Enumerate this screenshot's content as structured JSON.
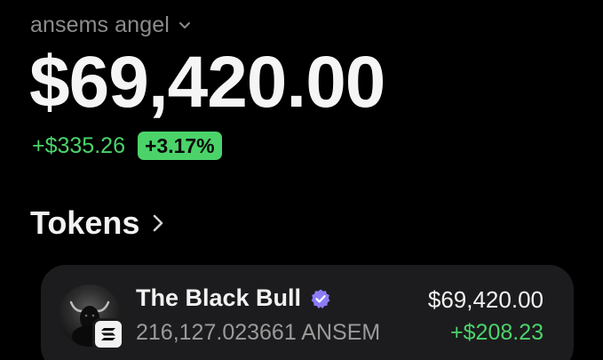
{
  "account": {
    "name": "ansems angel",
    "dropdown_icon": "chevron-down-icon"
  },
  "balance": {
    "total": "$69,420.00",
    "change_amount": "+$335.26",
    "change_percent": "+3.17%"
  },
  "tokens_section": {
    "title": "Tokens",
    "icon": "chevron-right-icon"
  },
  "tokens": [
    {
      "name": "The Black Bull",
      "verified": true,
      "amount": "216,127.023661 ANSEM",
      "value": "$69,420.00",
      "change": "+$208.23",
      "chain_icon": "solana-icon"
    }
  ],
  "colors": {
    "background": "#000000",
    "positive": "#4bd36a",
    "muted_text": "#8c8c8c",
    "card": "#1c1c1e",
    "verified": "#8b7cf6"
  }
}
